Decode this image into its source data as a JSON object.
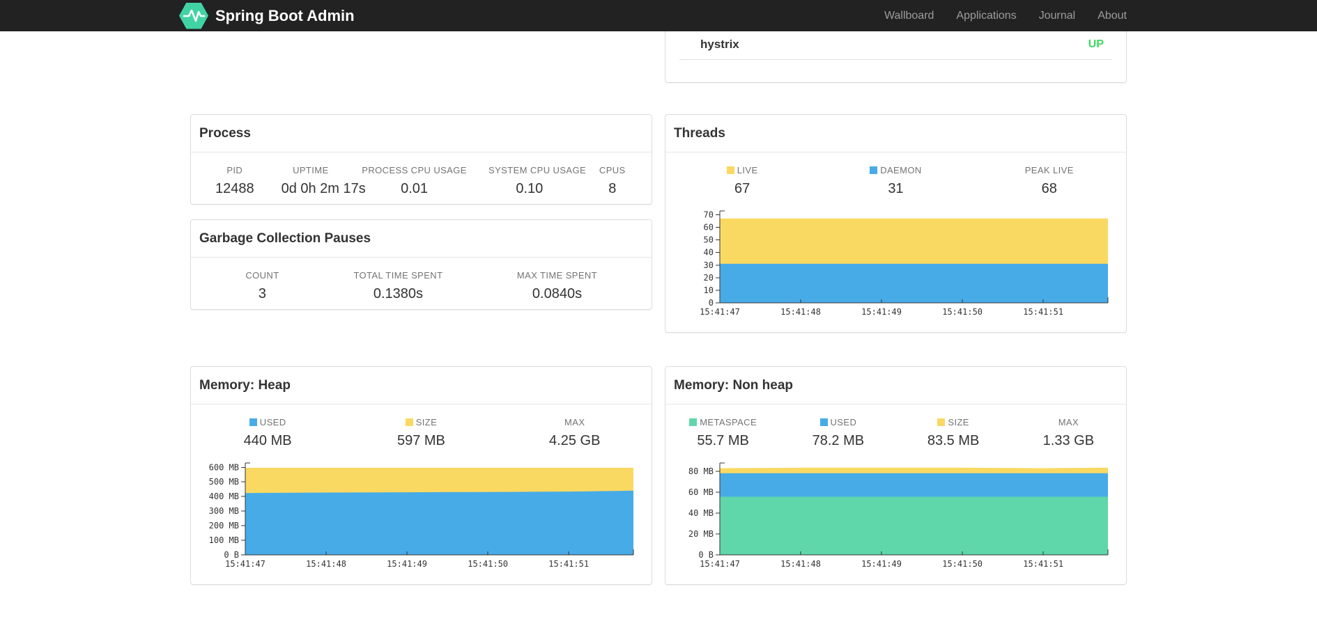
{
  "navbar": {
    "brand": "Spring Boot Admin",
    "links": [
      {
        "label": "Wallboard"
      },
      {
        "label": "Applications"
      },
      {
        "label": "Journal"
      },
      {
        "label": "About"
      }
    ],
    "colors": {
      "bg": "#222222",
      "link": "#9d9d9d",
      "brand_text": "#ffffff",
      "logo": "#42d3a5"
    }
  },
  "application_row": {
    "name": "hystrix",
    "status": "UP",
    "status_color": "#3fd860"
  },
  "panels": {
    "process": {
      "title": "Process",
      "stats": [
        {
          "label": "PID",
          "value": "12488"
        },
        {
          "label": "UPTIME",
          "value": "0d 0h 2m 17s"
        },
        {
          "label": "PROCESS CPU USAGE",
          "value": "0.01"
        },
        {
          "label": "SYSTEM CPU USAGE",
          "value": "0.10"
        },
        {
          "label": "CPUS",
          "value": "8"
        }
      ]
    },
    "gc": {
      "title": "Garbage Collection Pauses",
      "stats": [
        {
          "label": "COUNT",
          "value": "3"
        },
        {
          "label": "TOTAL TIME SPENT",
          "value": "0.1380s"
        },
        {
          "label": "MAX TIME SPENT",
          "value": "0.0840s"
        }
      ]
    },
    "threads": {
      "title": "Threads",
      "stats": [
        {
          "label": "LIVE",
          "value": "67"
        },
        {
          "label": "DAEMON",
          "value": "31"
        },
        {
          "label": "PEAK LIVE",
          "value": "68"
        }
      ]
    },
    "heap": {
      "title": "Memory: Heap",
      "stats": [
        {
          "label": "USED",
          "value": "440 MB"
        },
        {
          "label": "SIZE",
          "value": "597 MB"
        },
        {
          "label": "MAX",
          "value": "4.25 GB"
        }
      ]
    },
    "nonheap": {
      "title": "Memory: Non heap",
      "stats": [
        {
          "label": "METASPACE",
          "value": "55.7 MB"
        },
        {
          "label": "USED",
          "value": "78.2 MB"
        },
        {
          "label": "SIZE",
          "value": "83.5 MB"
        },
        {
          "label": "MAX",
          "value": "1.33 GB"
        }
      ]
    }
  },
  "chart_data": [
    {
      "type": "area",
      "title": "Threads",
      "x_tick_labels": [
        "15:41:47",
        "15:41:48",
        "15:41:49",
        "15:41:50",
        "15:41:51"
      ],
      "x_points": [
        0,
        1,
        2,
        3,
        4,
        4.8
      ],
      "x_domain": [
        0,
        4.8
      ],
      "ylim": [
        0,
        73
      ],
      "y_ticks": [
        {
          "v": 0,
          "label": "0"
        },
        {
          "v": 10,
          "label": "10"
        },
        {
          "v": 20,
          "label": "20"
        },
        {
          "v": 30,
          "label": "30"
        },
        {
          "v": 40,
          "label": "40"
        },
        {
          "v": 50,
          "label": "50"
        },
        {
          "v": 60,
          "label": "60"
        },
        {
          "v": 70,
          "label": "70"
        }
      ],
      "grid": false,
      "series": [
        {
          "name": "LIVE",
          "color": "#fad962",
          "values": [
            67,
            67,
            67,
            67,
            67,
            67
          ]
        },
        {
          "name": "DAEMON",
          "color": "#47abe8",
          "values": [
            31,
            31,
            31,
            31,
            31,
            31
          ]
        }
      ]
    },
    {
      "type": "area",
      "title": "Memory: Heap (MB)",
      "x_tick_labels": [
        "15:41:47",
        "15:41:48",
        "15:41:49",
        "15:41:50",
        "15:41:51"
      ],
      "x_points": [
        0,
        1,
        2,
        3,
        4,
        4.8
      ],
      "x_domain": [
        0,
        4.8
      ],
      "ylim": [
        0,
        630
      ],
      "y_ticks": [
        {
          "v": 0,
          "label": "0 B"
        },
        {
          "v": 100,
          "label": "100 MB"
        },
        {
          "v": 200,
          "label": "200 MB"
        },
        {
          "v": 300,
          "label": "300 MB"
        },
        {
          "v": 400,
          "label": "400 MB"
        },
        {
          "v": 500,
          "label": "500 MB"
        },
        {
          "v": 600,
          "label": "600 MB"
        }
      ],
      "grid": false,
      "series": [
        {
          "name": "USED",
          "color": "#47abe8",
          "values": [
            424,
            427,
            429,
            431,
            434,
            440
          ]
        },
        {
          "name": "SIZE",
          "color": "#fad962",
          "values": [
            597,
            597,
            597,
            597,
            597,
            597
          ]
        }
      ]
    },
    {
      "type": "area",
      "title": "Memory: Non heap (MB)",
      "x_tick_labels": [
        "15:41:47",
        "15:41:48",
        "15:41:49",
        "15:41:50",
        "15:41:51"
      ],
      "x_points": [
        0,
        1,
        2,
        3,
        4,
        4.8
      ],
      "x_domain": [
        0,
        4.8
      ],
      "ylim": [
        0,
        88
      ],
      "y_ticks": [
        {
          "v": 0,
          "label": "0 B"
        },
        {
          "v": 20,
          "label": "20 MB"
        },
        {
          "v": 40,
          "label": "40 MB"
        },
        {
          "v": 60,
          "label": "60 MB"
        },
        {
          "v": 80,
          "label": "80 MB"
        }
      ],
      "grid": false,
      "series": [
        {
          "name": "METASPACE",
          "color": "#5fd7ab",
          "values": [
            55.7,
            55.7,
            55.7,
            55.7,
            55.7,
            55.7
          ]
        },
        {
          "name": "USED",
          "color": "#47abe8",
          "values": [
            78.2,
            78.2,
            78.2,
            78.2,
            78.2,
            78.2
          ]
        },
        {
          "name": "SIZE",
          "color": "#fad962",
          "values": [
            83.0,
            83.5,
            83.5,
            83.5,
            83.0,
            83.5
          ]
        }
      ]
    }
  ]
}
